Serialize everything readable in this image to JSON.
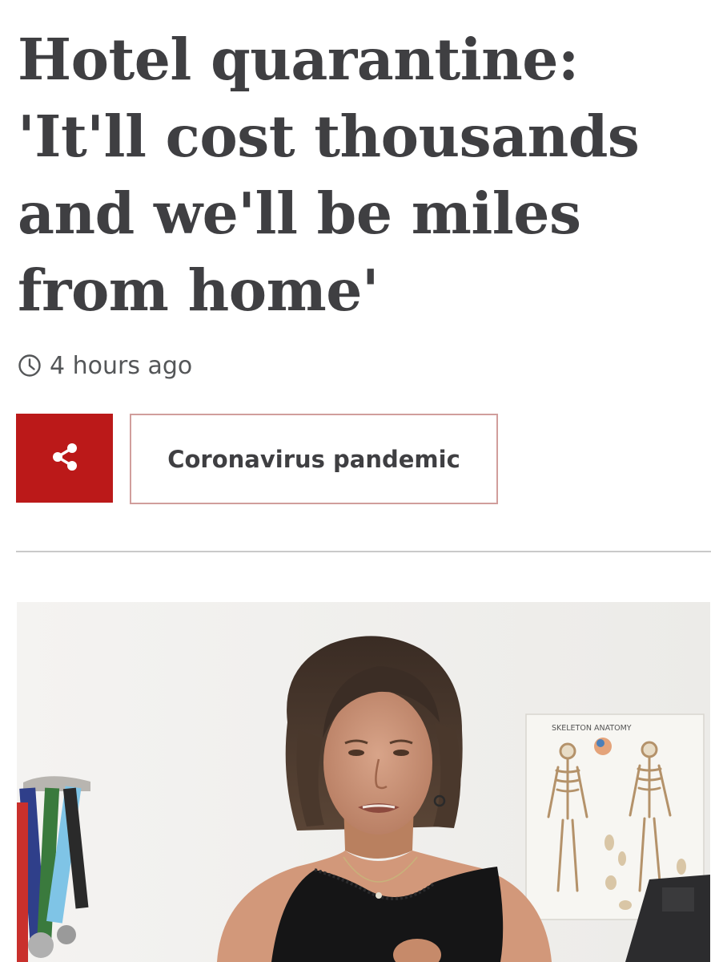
{
  "article": {
    "headline": "Hotel quarantine: 'It'll cost thousands and we'll be miles from home'",
    "timestamp": "4 hours ago",
    "topic_label": "Coronavirus pandemic"
  },
  "icons": {
    "timestamp": "clock-icon",
    "share": "share-icon"
  },
  "photo": {
    "poster_text": "SKELETON ANATOMY"
  },
  "colors": {
    "brand_red": "#bb1919",
    "topic_border": "#d19e9c",
    "text": "#3f3f42"
  }
}
